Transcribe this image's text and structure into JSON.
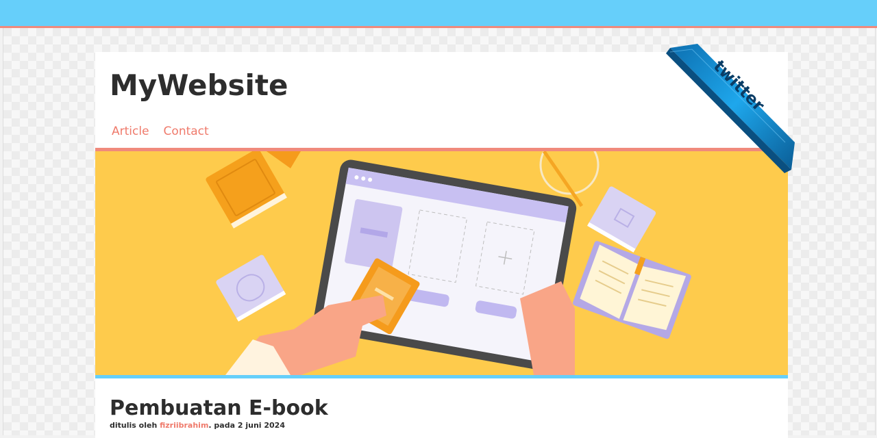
{
  "header": {
    "site_title": "MyWebsite",
    "nav": [
      {
        "label": "Article"
      },
      {
        "label": "Contact"
      }
    ]
  },
  "ribbon": {
    "label": "twitter",
    "color": "#1a8fd6"
  },
  "post": {
    "title": "Pembuatan E-book",
    "meta_prefix": "ditulis oleh ",
    "author": "fizriibrahim",
    "meta_suffix": ". pada 2 juni 2024"
  },
  "colors": {
    "topbar": "#66cffa",
    "accent": "#f08a7c",
    "hero_bg": "#fecb4c",
    "text": "#2d2d2d"
  }
}
